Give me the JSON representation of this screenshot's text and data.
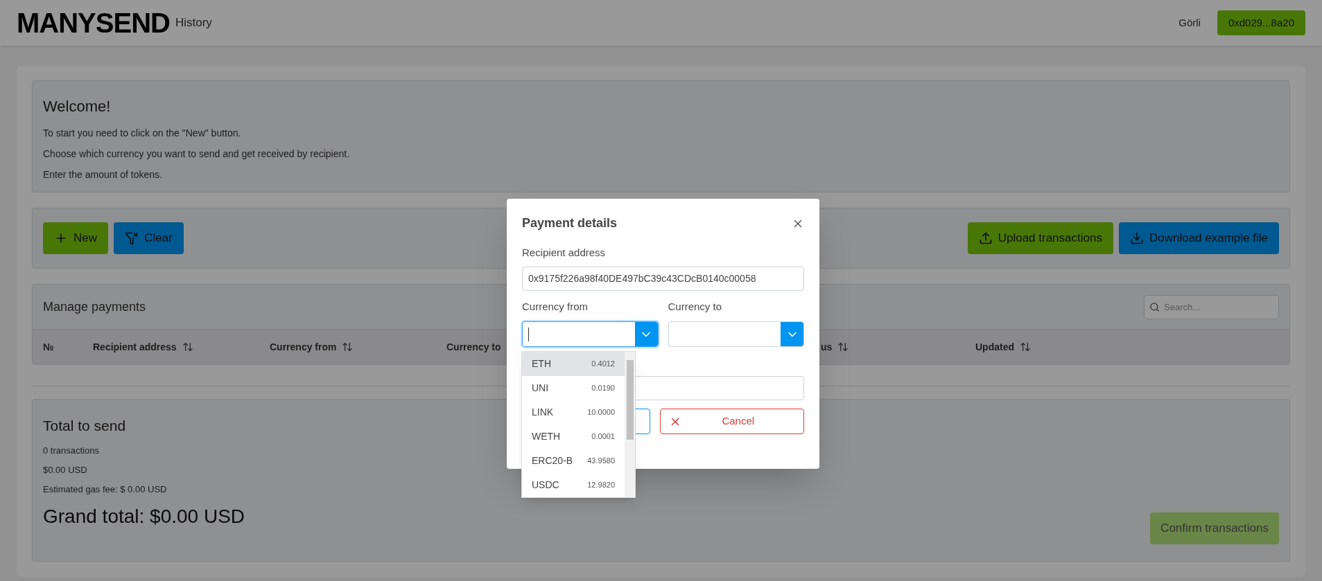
{
  "header": {
    "logo": "MANYSEND",
    "nav_link": "History",
    "network": "Görli",
    "wallet_button": "0xd029...8a20"
  },
  "welcome": {
    "title": "Welcome!",
    "lines": [
      "To start you need to click on the \"New\" button.",
      "Choose which currency you want to send and get received by recipient.",
      "Enter the amount of tokens."
    ]
  },
  "toolbar": {
    "left_buttons": [
      {
        "label": "New",
        "kind": "add"
      },
      {
        "label": "Clear",
        "kind": "clear"
      }
    ],
    "right_buttons": [
      {
        "label": "Upload transactions",
        "kind": "upload"
      },
      {
        "label": "Download example file",
        "kind": "download"
      }
    ]
  },
  "payments": {
    "title": "Manage payments",
    "search": {
      "placeholder": "Search..."
    },
    "columns": [
      {
        "label": "№",
        "sortable": false
      },
      {
        "label": "Recipient address",
        "sortable": true
      },
      {
        "label": "Currency from",
        "sortable": true
      },
      {
        "label": "Currency to",
        "sortable": false
      },
      {
        "label": "us",
        "sortable": true
      },
      {
        "label": "Updated",
        "sortable": true
      }
    ]
  },
  "totals": {
    "title": "Total to send",
    "lines": [
      "0 transactions",
      "$0.00 USD",
      "Estimated gas fee: $ 0.00 USD"
    ],
    "grand_total": "Grand total: $0.00 USD",
    "confirm_button": {
      "label": "Confirm transactions",
      "disabled": true
    }
  },
  "modal": {
    "title": "Payment details",
    "recipient": {
      "label": "Recipient address",
      "value": "0x9175f226a98f40DE497bC39c43CDcB0140c00058"
    },
    "currency_from": {
      "label": "Currency from",
      "focused": true
    },
    "currency_to": {
      "label": "Currency to",
      "focused": false
    },
    "cancel_button": "Cancel",
    "options": [
      {
        "symbol": "ETH",
        "balance": "0.4012",
        "selected": true
      },
      {
        "symbol": "UNI",
        "balance": "0.0190",
        "selected": false
      },
      {
        "symbol": "LINK",
        "balance": "10.0000",
        "selected": false
      },
      {
        "symbol": "WETH",
        "balance": "0.0001",
        "selected": false
      },
      {
        "symbol": "ERC20-B",
        "balance": "43.9580",
        "selected": false
      },
      {
        "symbol": "USDC",
        "balance": "12.9820",
        "selected": false
      }
    ]
  }
}
